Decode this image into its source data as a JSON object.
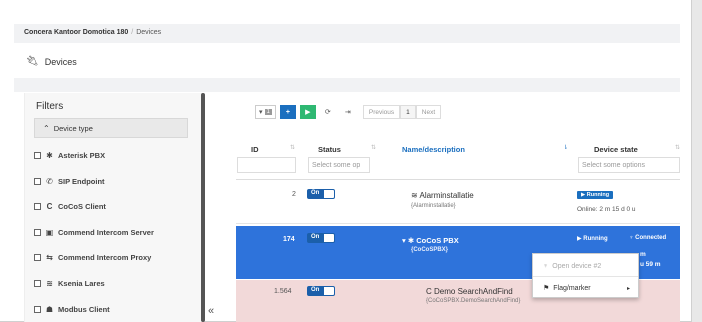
{
  "breadcrumb": {
    "home": "Concera Kantoor Domotica 180",
    "separator": "/",
    "current": "Devices"
  },
  "page": {
    "title": "Devices",
    "title_icon": "plug-icon"
  },
  "filters": {
    "title": "Filters",
    "group_label": "Device type",
    "items": [
      {
        "label": "Asterisk PBX",
        "icon": "asterisk-icon",
        "glyph": "✱"
      },
      {
        "label": "SIP Endpoint",
        "icon": "phone-icon",
        "glyph": "✆"
      },
      {
        "label": "CoCoS Client",
        "icon": "cocos-icon",
        "glyph": "C"
      },
      {
        "label": "Commend Intercom Server",
        "icon": "server-icon",
        "glyph": "▣"
      },
      {
        "label": "Commend Intercom Proxy",
        "icon": "proxy-icon",
        "glyph": "⇆"
      },
      {
        "label": "Ksenia Lares",
        "icon": "alarm-icon",
        "glyph": "≋"
      },
      {
        "label": "Modbus Client",
        "icon": "modbus-icon",
        "glyph": "☗"
      }
    ],
    "collapse_glyph": "«"
  },
  "toolbar": {
    "dropdown_count": "1",
    "add_label": "+",
    "play_label": "▶",
    "refresh_glyph": "⟳",
    "export_glyph": "⇥",
    "pager": {
      "previous": "Previous",
      "current": "1",
      "next": "Next"
    }
  },
  "table": {
    "headers": {
      "id": "ID",
      "status": "Status",
      "name": "Name/description",
      "state": "Device state"
    },
    "filter_placeholders": {
      "status": "Select some op",
      "state": "Select some options"
    },
    "rows": [
      {
        "id": "2",
        "toggle": "On",
        "name": "Alarminstallatie",
        "name_icon": "≋",
        "desc": "{Alarminstallatie}",
        "state_badge": "▶ Running",
        "state_text": "Online: 2 m 15 d 0 u"
      },
      {
        "id": "174",
        "toggle": "On",
        "name": "▾ ✱ CoCoS PBX",
        "desc": "{CoCoSPBX}",
        "state_badge": "▶ Running",
        "connected": "♆ Connected",
        "state_text_1": "m",
        "state_text_2": "u 59 m"
      },
      {
        "id": "1.564",
        "toggle": "On",
        "name": "C Demo SearchAndFind",
        "desc": "{CoCoSPBX.DemoSearchAndFind}"
      }
    ]
  },
  "context_menu": {
    "open_label": "Open device #2",
    "open_glyph": "♆",
    "flag_label": "Flag/marker",
    "flag_glyph": "⚑",
    "caret": "▸"
  }
}
